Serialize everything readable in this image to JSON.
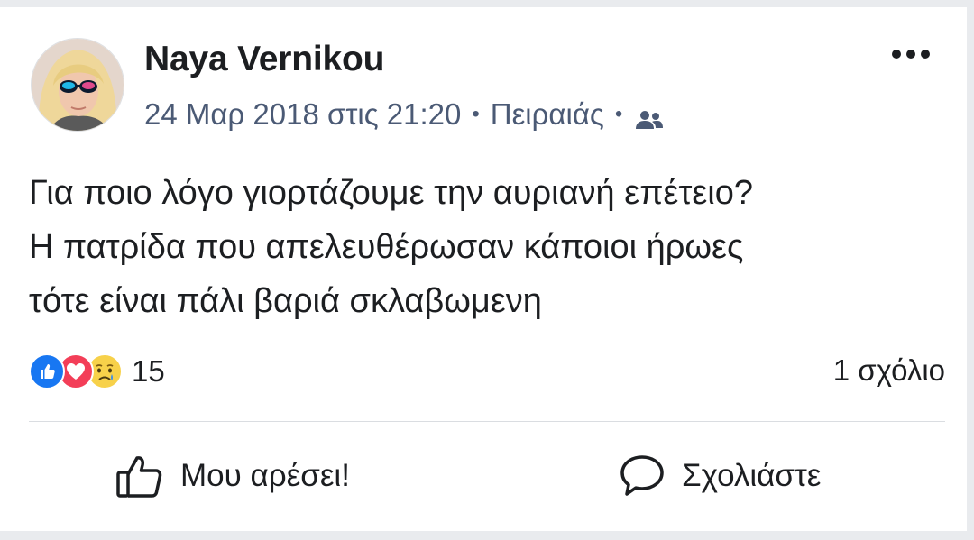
{
  "post": {
    "author": "Naya Vernikou",
    "date": "24 Μαρ 2018 στις 21:20",
    "location": "Πειραιάς",
    "separator": "•",
    "audience_icon": "friends-icon",
    "text_lines": [
      "Για ποιο λόγο γιορτάζουμε την αυριανή επέτειο?",
      "Η πατρίδα που απελευθέρωσαν κάποιοι ήρωες",
      "τότε είναι πάλι βαριά σκλαβωμενη"
    ]
  },
  "reactions": {
    "icons": [
      "like-reaction-icon",
      "love-reaction-icon",
      "sad-reaction-icon"
    ],
    "count": "15"
  },
  "comments": {
    "count_label": "1 σχόλιο"
  },
  "actions": {
    "like_label": "Μου αρέσει!",
    "comment_label": "Σχολιάστε"
  },
  "colors": {
    "like_blue": "#1877f2",
    "love_red": "#f33e58",
    "sad_yellow": "#f7b928",
    "meta_gray": "#4b5a75"
  }
}
